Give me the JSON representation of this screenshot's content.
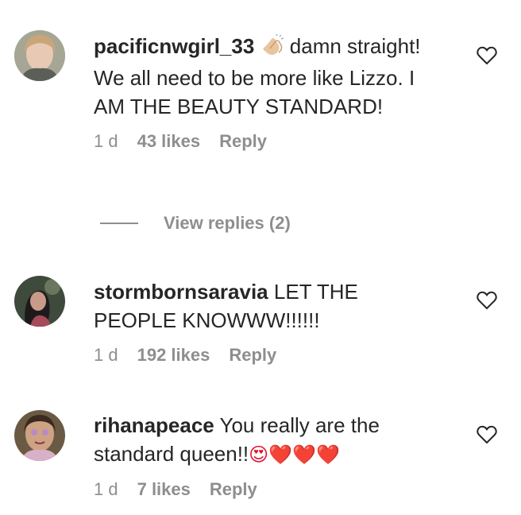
{
  "comments": [
    {
      "username": "pacificnwgirl_33",
      "text_a": "damn straight! We all need to be more like Lizzo. I AM THE BEAUTY STANDARD!",
      "time": "1 d",
      "likes": "43 likes",
      "reply": "Reply",
      "view_replies": "View replies (2)",
      "emoji_icon": "clapping-hands-icon"
    },
    {
      "username": "stormbornsaravia",
      "text_a": "LET THE PEOPLE KNOWWW!!!!!!",
      "time": "1 d",
      "likes": "192 likes",
      "reply": "Reply"
    },
    {
      "username": "rihanapeace",
      "text_a": "You really are the standard queen!!",
      "emoji_tail": "😍❤️❤️❤️",
      "time": "1 d",
      "likes": "7 likes",
      "reply": "Reply"
    }
  ],
  "colors": {
    "text": "#262626",
    "secondary": "#8e8e8e",
    "heart_emoji": "#e0102b"
  }
}
